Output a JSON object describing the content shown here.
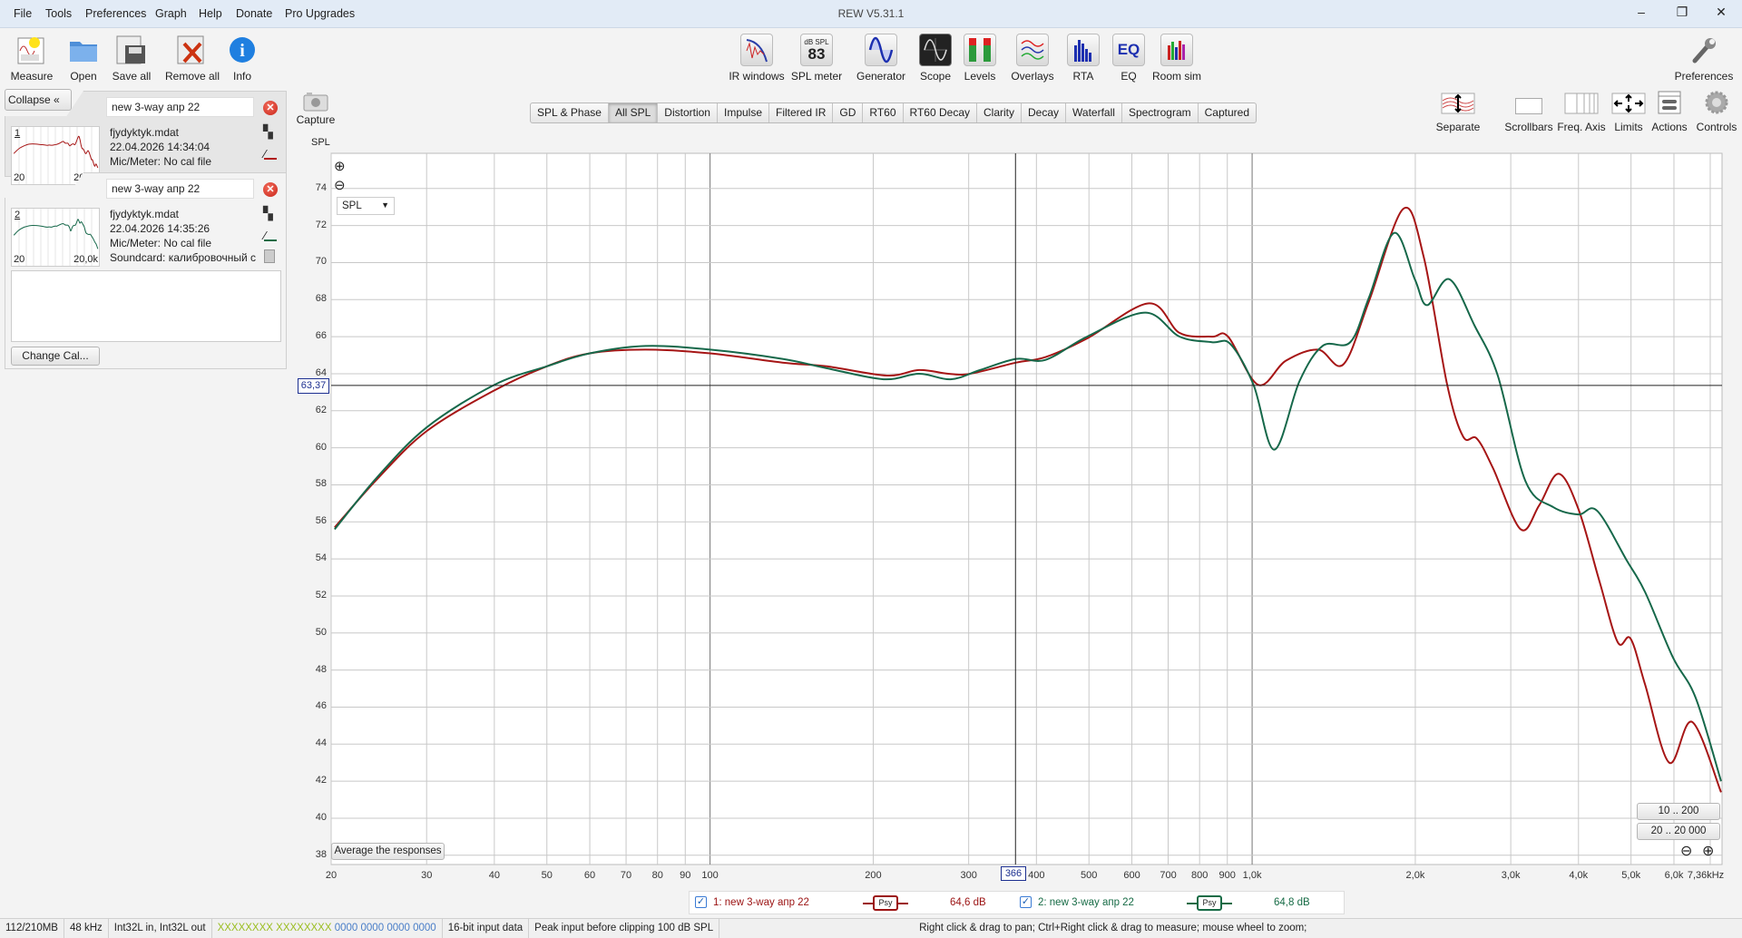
{
  "window": {
    "title": "REW V5.31.1",
    "minimize": "–",
    "maximize": "❐",
    "close": "✕"
  },
  "menu": [
    "File",
    "Tools",
    "Preferences",
    "Graph",
    "Help",
    "Donate",
    "Pro Upgrades"
  ],
  "toolbar_left": [
    {
      "label": "Measure",
      "icon": "measure-icon"
    },
    {
      "label": "Open",
      "icon": "folder-icon"
    },
    {
      "label": "Save all",
      "icon": "save-icon"
    },
    {
      "label": "Remove all",
      "icon": "remove-icon"
    },
    {
      "label": "Info",
      "icon": "info-icon"
    }
  ],
  "toolbar_center": [
    {
      "label": "IR windows",
      "icon": "ir-windows-icon"
    },
    {
      "label": "SPL meter",
      "icon": "spl-meter-icon",
      "value": "83",
      "unit": "dB SPL"
    },
    {
      "label": "Generator",
      "icon": "sine-icon"
    },
    {
      "label": "Scope",
      "icon": "scope-icon"
    },
    {
      "label": "Levels",
      "icon": "levels-icon"
    },
    {
      "label": "Overlays",
      "icon": "overlays-icon"
    },
    {
      "label": "RTA",
      "icon": "rta-icon"
    },
    {
      "label": "EQ",
      "icon": "eq-icon"
    },
    {
      "label": "Room sim",
      "icon": "room-sim-icon"
    }
  ],
  "preferences": "Preferences",
  "capture": "Capture",
  "tabs": [
    "SPL & Phase",
    "All SPL",
    "Distortion",
    "Impulse",
    "Filtered IR",
    "GD",
    "RT60",
    "RT60 Decay",
    "Clarity",
    "Decay",
    "Waterfall",
    "Spectrogram",
    "Captured"
  ],
  "active_tab": "All SPL",
  "graph_buttons": [
    "Separate",
    "Scrollbars",
    "Freq. Axis",
    "Limits",
    "Actions",
    "Controls"
  ],
  "panel": {
    "collapse": "Collapse",
    "change_cal": "Change Cal...",
    "measurements": [
      {
        "index": "1",
        "name": "new 3-way апр 22",
        "file": "fjydyktyk.mdat",
        "date": "22.04.2026 14:34:04",
        "mic": "Mic/Meter: No cal file",
        "soundcard": "Soundcard: калибровочный с",
        "thumb_left": "20",
        "thumb_right": "20,0k",
        "color": "#b01818"
      },
      {
        "index": "2",
        "name": "new 3-way апр 22",
        "file": "fjydyktyk.mdat",
        "date": "22.04.2026 14:35:26",
        "mic": "Mic/Meter: No cal file",
        "soundcard": "Soundcard: калибровочный с",
        "thumb_left": "20",
        "thumb_right": "20,0k",
        "color": "#166b45"
      }
    ]
  },
  "graph": {
    "y_unit": "SPL",
    "selector": "SPL",
    "cursor_y_label": "63,37",
    "cursor_x_label": "366",
    "average_button": "Average the responses",
    "range_buttons": [
      "10 .. 200",
      "20 .. 20 000"
    ]
  },
  "legend": [
    {
      "label": "1: new 3-way апр 22",
      "badge": "Psy",
      "value": "64,6 dB",
      "color": "#9b1212",
      "checked": true
    },
    {
      "label": "2: new 3-way апр 22",
      "badge": "Psy",
      "value": "64,8 dB",
      "color": "#166b45",
      "checked": true
    }
  ],
  "status": {
    "memory": "112/210MB",
    "rate": "48 kHz",
    "format": "Int32L in, Int32L out",
    "in_bits": "XXXXXXXX",
    "out_bits": "XXXXXXXX",
    "bits_a": "0000 0000",
    "bits_b": "0000 0000",
    "input_data": "16-bit input data",
    "peak": "Peak input before clipping 100 dB SPL",
    "hint": "Right click & drag to pan; Ctrl+Right click & drag to measure; mouse wheel to zoom;"
  },
  "chart_data": {
    "type": "line",
    "x_scale": "log",
    "xlim": [
      20,
      7360
    ],
    "ylim": [
      37.5,
      75.9
    ],
    "ylabel": "SPL",
    "grid": true,
    "y_ticks": [
      38,
      40,
      42,
      44,
      46,
      48,
      50,
      52,
      54,
      56,
      58,
      60,
      62,
      64,
      66,
      68,
      70,
      72,
      74
    ],
    "x_ticks": [
      {
        "f": 20,
        "label": "20"
      },
      {
        "f": 30,
        "label": "30"
      },
      {
        "f": 40,
        "label": "40"
      },
      {
        "f": 50,
        "label": "50"
      },
      {
        "f": 60,
        "label": "60"
      },
      {
        "f": 70,
        "label": "70"
      },
      {
        "f": 80,
        "label": "80"
      },
      {
        "f": 90,
        "label": "90"
      },
      {
        "f": 100,
        "label": "100"
      },
      {
        "f": 200,
        "label": "200"
      },
      {
        "f": 300,
        "label": "300"
      },
      {
        "f": 400,
        "label": "400"
      },
      {
        "f": 500,
        "label": "500"
      },
      {
        "f": 600,
        "label": "600"
      },
      {
        "f": 700,
        "label": "700"
      },
      {
        "f": 800,
        "label": "800"
      },
      {
        "f": 900,
        "label": "900"
      },
      {
        "f": 1000,
        "label": "1,0k"
      },
      {
        "f": 2000,
        "label": "2,0k"
      },
      {
        "f": 3000,
        "label": "3,0k"
      },
      {
        "f": 4000,
        "label": "4,0k"
      },
      {
        "f": 5000,
        "label": "5,0k"
      },
      {
        "f": 6000,
        "label": "6,0k"
      },
      {
        "f": 7360,
        "label": "7,36kHz"
      }
    ],
    "cursor": {
      "x": 366,
      "y": 63.37
    },
    "series": [
      {
        "name": "1: new 3-way апр 22",
        "color": "#a61515",
        "points": [
          [
            20.3,
            55.7
          ],
          [
            24.3,
            58.3
          ],
          [
            30,
            60.9
          ],
          [
            40,
            63.1
          ],
          [
            50,
            64.4
          ],
          [
            60,
            65.1
          ],
          [
            76,
            65.3
          ],
          [
            100,
            65.1
          ],
          [
            136,
            64.6
          ],
          [
            164,
            64.4
          ],
          [
            212,
            63.9
          ],
          [
            243,
            64.2
          ],
          [
            275,
            64.0
          ],
          [
            302,
            64.0
          ],
          [
            367,
            64.6
          ],
          [
            416,
            64.9
          ],
          [
            496,
            65.9
          ],
          [
            645,
            67.8
          ],
          [
            735,
            66.2
          ],
          [
            843,
            66.0
          ],
          [
            903,
            66.0
          ],
          [
            1026,
            63.4
          ],
          [
            1154,
            64.7
          ],
          [
            1323,
            65.3
          ],
          [
            1473,
            64.5
          ],
          [
            1642,
            67.9
          ],
          [
            1900,
            72.9
          ],
          [
            2073,
            70.3
          ],
          [
            2290,
            63.4
          ],
          [
            2451,
            60.6
          ],
          [
            2597,
            60.5
          ],
          [
            2782,
            58.9
          ],
          [
            3129,
            55.6
          ],
          [
            3386,
            56.9
          ],
          [
            3676,
            58.6
          ],
          [
            3998,
            56.7
          ],
          [
            4372,
            52.8
          ],
          [
            4726,
            49.5
          ],
          [
            4990,
            49.7
          ],
          [
            5310,
            47.2
          ],
          [
            5880,
            43.0
          ],
          [
            6480,
            45.2
          ],
          [
            7330,
            41.4
          ]
        ]
      },
      {
        "name": "2: new 3-way апр 22",
        "color": "#16684a",
        "points": [
          [
            20.3,
            55.6
          ],
          [
            24.3,
            58.4
          ],
          [
            30,
            61.1
          ],
          [
            40,
            63.4
          ],
          [
            50,
            64.4
          ],
          [
            60,
            65.1
          ],
          [
            76,
            65.5
          ],
          [
            100,
            65.3
          ],
          [
            136,
            64.8
          ],
          [
            164,
            64.3
          ],
          [
            209,
            63.7
          ],
          [
            243,
            64.0
          ],
          [
            278,
            63.7
          ],
          [
            315,
            64.2
          ],
          [
            367,
            64.8
          ],
          [
            416,
            64.75
          ],
          [
            496,
            66.0
          ],
          [
            635,
            67.3
          ],
          [
            735,
            66.0
          ],
          [
            843,
            65.7
          ],
          [
            912,
            65.6
          ],
          [
            1006,
            63.4
          ],
          [
            1099,
            59.9
          ],
          [
            1223,
            63.6
          ],
          [
            1349,
            65.5
          ],
          [
            1517,
            65.7
          ],
          [
            1642,
            68.1
          ],
          [
            1827,
            71.6
          ],
          [
            1996,
            69.1
          ],
          [
            2103,
            67.7
          ],
          [
            2311,
            69.1
          ],
          [
            2572,
            66.6
          ],
          [
            2839,
            63.9
          ],
          [
            3193,
            58.2
          ],
          [
            3591,
            56.8
          ],
          [
            3998,
            56.4
          ],
          [
            4330,
            56.6
          ],
          [
            4914,
            53.9
          ],
          [
            5310,
            52.2
          ],
          [
            5970,
            48.7
          ],
          [
            6580,
            46.5
          ],
          [
            7330,
            42.0
          ]
        ]
      }
    ]
  }
}
